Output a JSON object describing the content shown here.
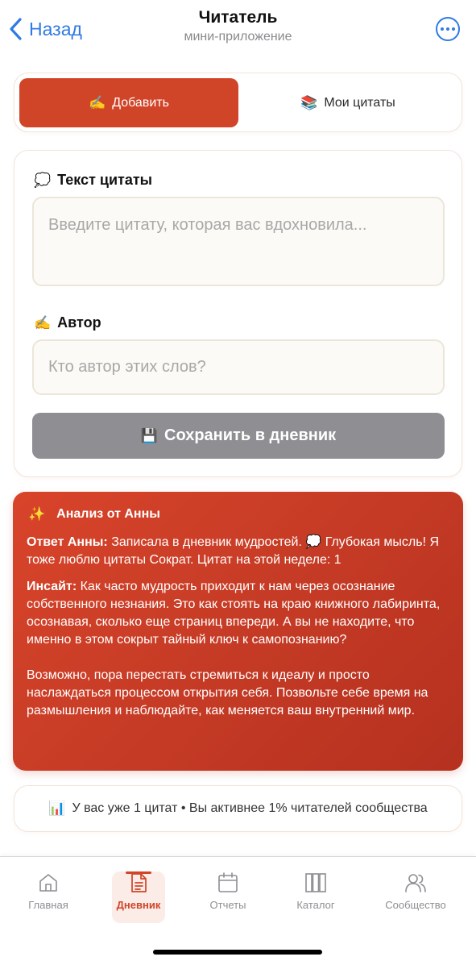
{
  "header": {
    "back_label": "Назад",
    "title": "Читатель",
    "subtitle": "мини-приложение"
  },
  "tabs": [
    {
      "icon": "writing-hand-icon",
      "emoji": "✍️",
      "label": "Добавить",
      "active": true
    },
    {
      "icon": "books-icon",
      "emoji": "📚",
      "label": "Мои цитаты",
      "active": false
    }
  ],
  "form": {
    "quote_label_emoji": "💭",
    "quote_label": "Текст цитаты",
    "quote_placeholder": "Введите цитату, которая вас вдохновила...",
    "quote_value": "",
    "author_label_emoji": "✍️",
    "author_label": "Автор",
    "author_placeholder": "Кто автор этих слов?",
    "author_value": "",
    "save_emoji": "💾",
    "save_label": "Сохранить в дневник"
  },
  "analysis": {
    "emoji": "✨",
    "title": "Анализ от Анны",
    "reply_label": "Ответ Анны:",
    "reply_text": " Записала в дневник мудростей. 💭 Глубокая мысль! Я тоже люблю цитаты Сократ. Цитат на этой неделе: 1",
    "insight_label": "Инсайт:",
    "insight_text": " Как часто мудрость приходит к нам через осознание собственного незнания. Это как стоять на краю книжного лабиринта, осознавая, сколько еще страниц впереди. А вы не находите, что именно в этом сокрыт тайный ключ к самопознанию?",
    "closing_text": "Возможно, пора перестать стремиться к идеалу и просто наслаждаться процессом открытия себя. Позвольте себе время на размышления и наблюдайте, как меняется ваш внутренний мир."
  },
  "stats": {
    "emoji": "📊",
    "text": "У вас уже 1 цитат • Вы активнее 1% читателей сообщества"
  },
  "bottom_nav": [
    {
      "icon": "home-icon",
      "label": "Главная",
      "active": false
    },
    {
      "icon": "diary-icon",
      "label": "Дневник",
      "active": true
    },
    {
      "icon": "calendar-icon",
      "label": "Отчеты",
      "active": false
    },
    {
      "icon": "catalog-icon",
      "label": "Каталог",
      "active": false
    },
    {
      "icon": "community-icon",
      "label": "Сообщество",
      "active": false
    }
  ],
  "colors": {
    "accent": "#d04428",
    "link_blue": "#2f7ae5",
    "disabled_button": "#8e8e93",
    "field_bg": "#fcfaf6"
  }
}
